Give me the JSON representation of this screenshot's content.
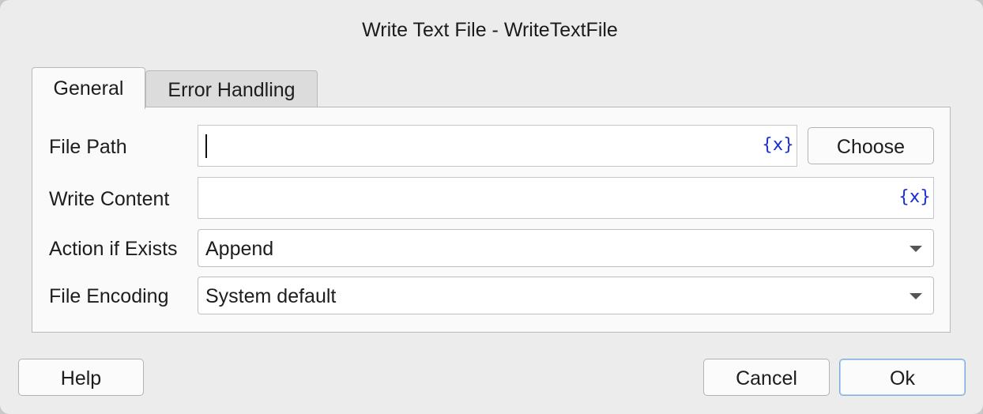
{
  "dialog": {
    "title": "Write Text File - WriteTextFile"
  },
  "tabs": {
    "general": "General",
    "error_handling": "Error Handling"
  },
  "form": {
    "file_path": {
      "label": "File Path",
      "value": "",
      "var_icon": "{x}",
      "choose_label": "Choose"
    },
    "write_content": {
      "label": "Write Content",
      "value": "",
      "var_icon": "{x}"
    },
    "action_if_exists": {
      "label": "Action if Exists",
      "selected": "Append"
    },
    "file_encoding": {
      "label": "File Encoding",
      "selected": "System default"
    }
  },
  "footer": {
    "help_label": "Help",
    "cancel_label": "Cancel",
    "ok_label": "Ok"
  },
  "colors": {
    "variable_icon": "#1a2fd6",
    "default_button_border": "#7ea8dd"
  }
}
